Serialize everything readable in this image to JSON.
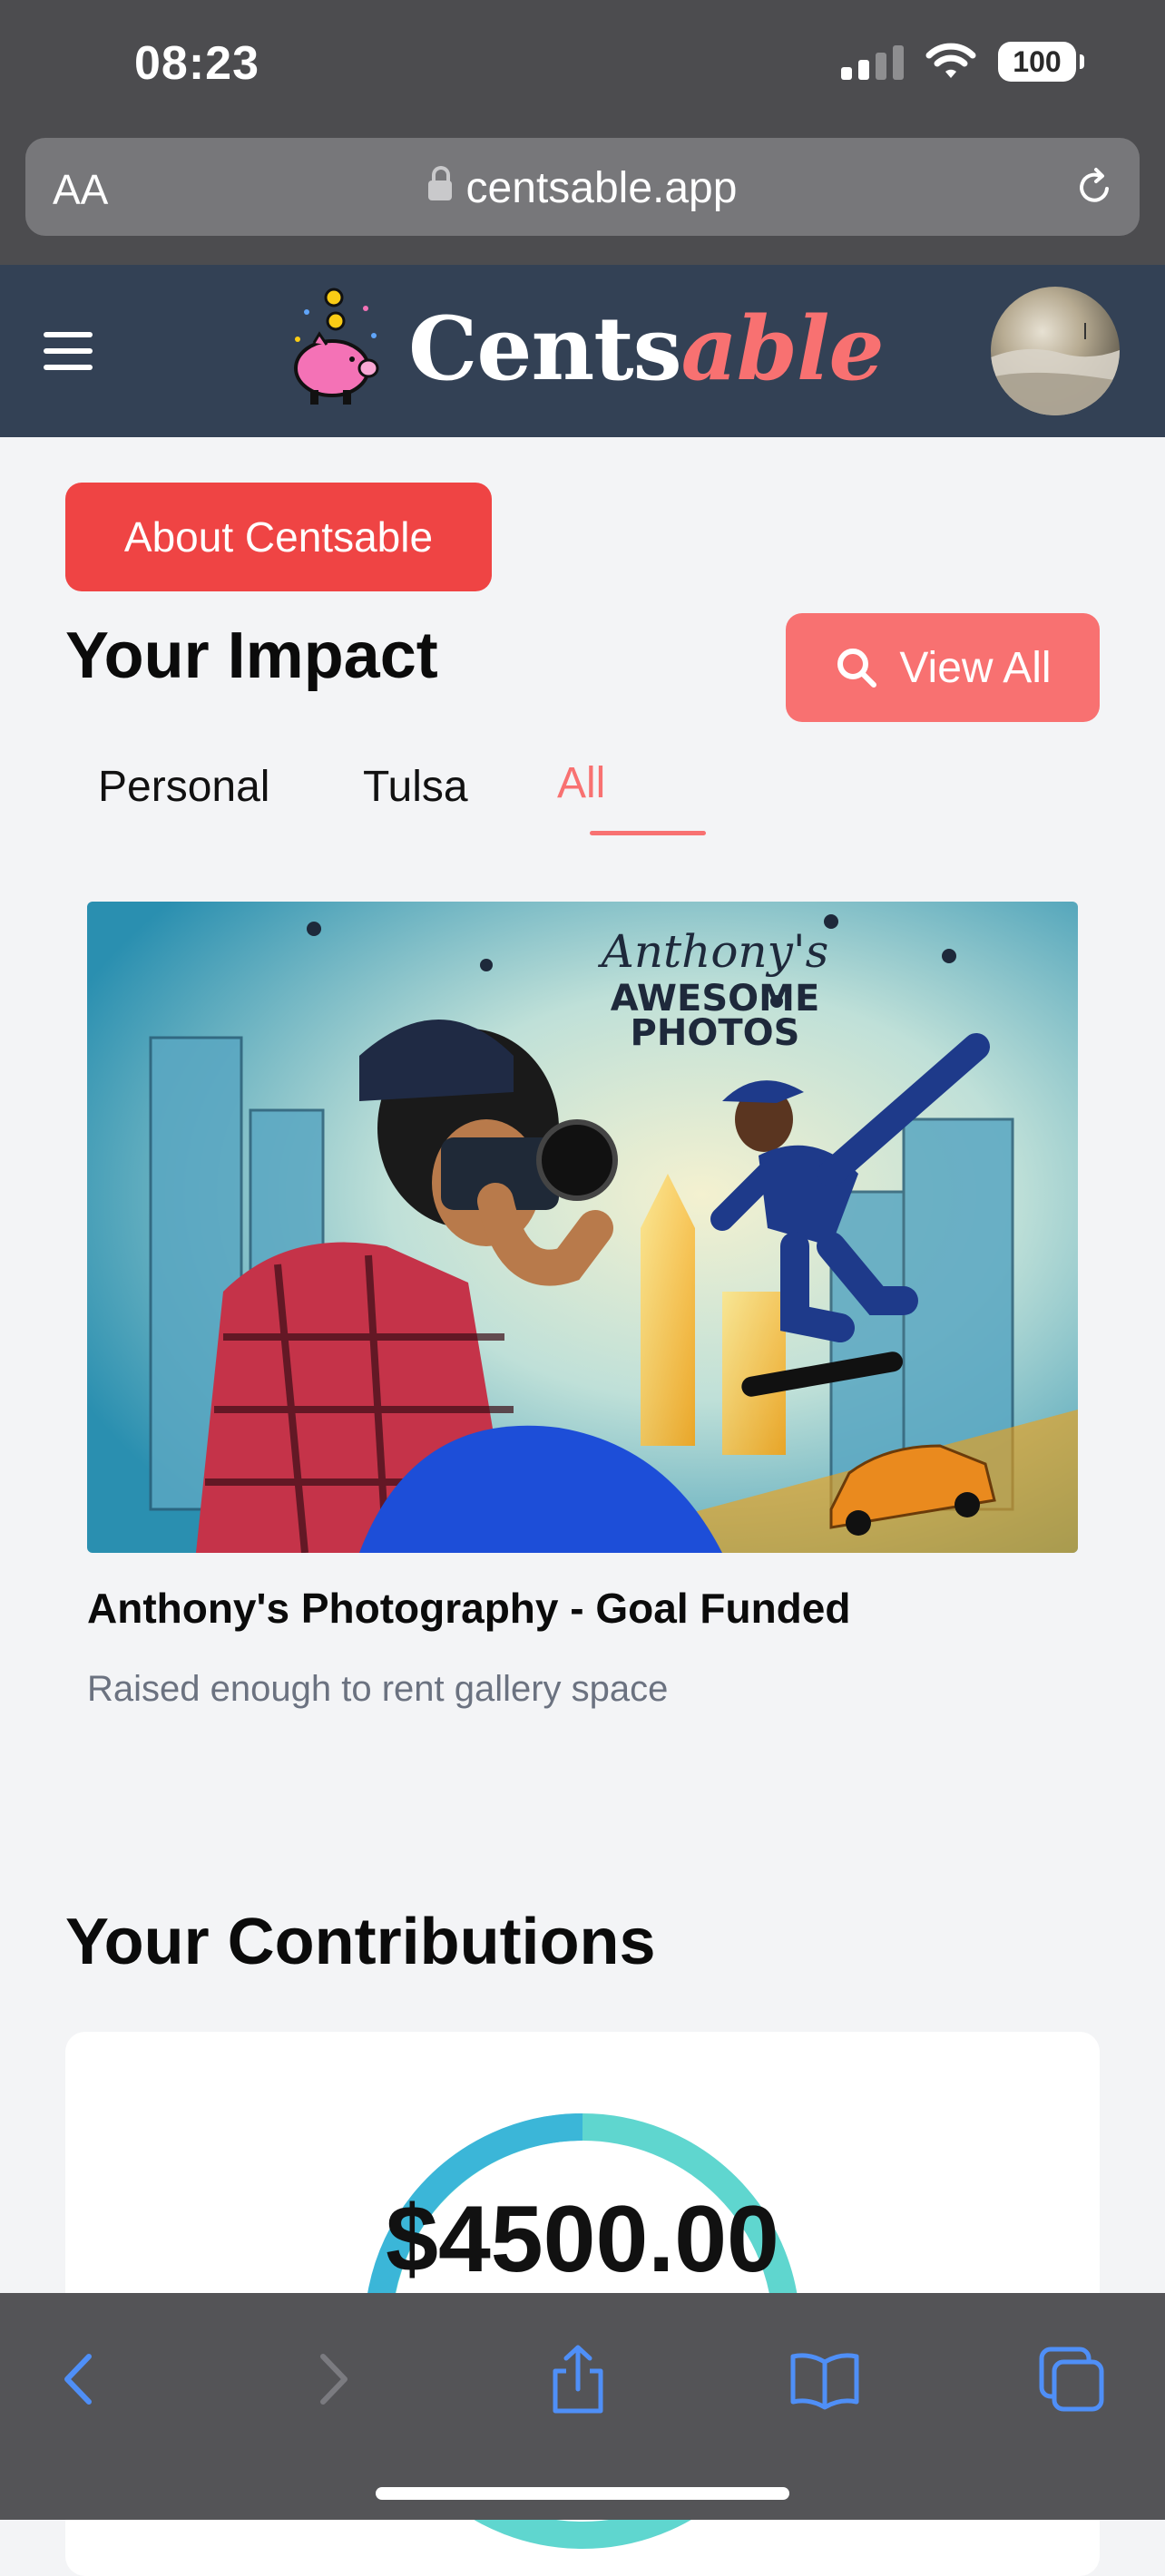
{
  "status_bar": {
    "time": "08:23",
    "battery": "100"
  },
  "browser": {
    "aa_label": "AA",
    "url": "centsable.app"
  },
  "header": {
    "logo_primary": "Cents",
    "logo_accent": "able"
  },
  "about_button": "About Centsable",
  "impact": {
    "title": "Your Impact",
    "view_all": "View All",
    "tabs": [
      {
        "label": "Personal",
        "active": false
      },
      {
        "label": "Tulsa",
        "active": false
      },
      {
        "label": "All",
        "active": true
      }
    ],
    "card": {
      "poster_line1": "Anthony's",
      "poster_line2": "AWESOME",
      "poster_line3": "PHOTOS",
      "title": "Anthony's Photography - Goal Funded",
      "subtitle": "Raised enough to rent gallery space"
    }
  },
  "contributions": {
    "title": "Your Contributions",
    "amount": "$4500.00"
  },
  "colors": {
    "header_bg": "#334155",
    "primary_red": "#ef4444",
    "accent_coral": "#f87171",
    "page_bg": "#f3f4f6",
    "donut_blue": "#3bb6d8",
    "donut_teal": "#5fd6cf"
  },
  "icons": [
    "menu-icon",
    "piggy-bank-icon",
    "search-icon",
    "lock-icon",
    "reload-icon",
    "back-icon",
    "forward-icon",
    "share-icon",
    "bookmarks-icon",
    "tabs-icon"
  ]
}
